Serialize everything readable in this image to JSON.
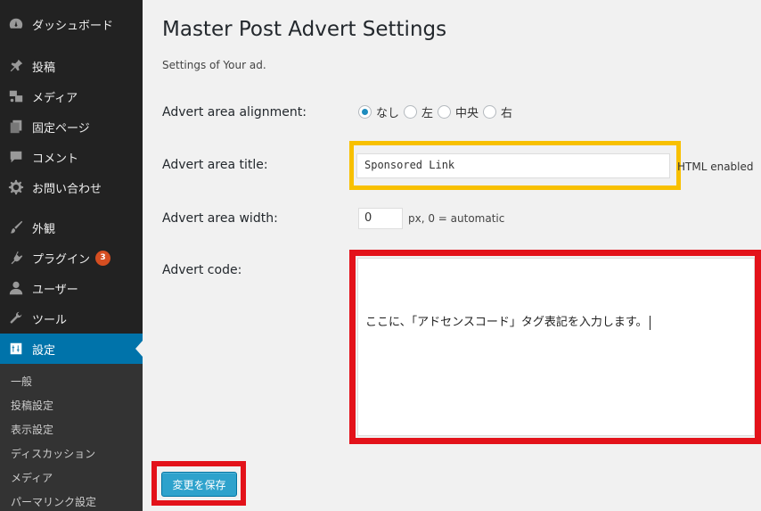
{
  "sidebar": {
    "items": [
      {
        "label": "ダッシュボード",
        "icon": "dashboard-icon"
      },
      {
        "label": "投稿",
        "icon": "pin-icon"
      },
      {
        "label": "メディア",
        "icon": "media-icon"
      },
      {
        "label": "固定ページ",
        "icon": "pages-icon"
      },
      {
        "label": "コメント",
        "icon": "comment-icon"
      },
      {
        "label": "お問い合わせ",
        "icon": "gear-icon"
      },
      {
        "label": "外観",
        "icon": "brush-icon"
      },
      {
        "label": "プラグイン",
        "icon": "plugin-icon",
        "badge": "3"
      },
      {
        "label": "ユーザー",
        "icon": "user-icon"
      },
      {
        "label": "ツール",
        "icon": "wrench-icon"
      },
      {
        "label": "設定",
        "icon": "settings-icon",
        "active": true
      }
    ],
    "submenu": [
      "一般",
      "投稿設定",
      "表示設定",
      "ディスカッション",
      "メディア",
      "パーマリンク設定"
    ]
  },
  "page": {
    "title": "Master Post Advert Settings",
    "subtitle": "Settings of Your ad."
  },
  "form": {
    "alignment": {
      "label": "Advert area alignment:",
      "options": [
        "なし",
        "左",
        "中央",
        "右"
      ],
      "selected": "なし"
    },
    "title": {
      "label": "Advert area title:",
      "value": "Sponsored Link",
      "note": "HTML enabled"
    },
    "width": {
      "label": "Advert area width:",
      "value": "0",
      "note": "px, 0 = automatic"
    },
    "code": {
      "label": "Advert code:",
      "value": "ここに、「アドセンスコード」タグ表記を入力します。"
    },
    "save_label": "変更を保存"
  },
  "colors": {
    "accent": "#0073aa",
    "highlight_yellow": "#f8c000",
    "highlight_red": "#e3121a",
    "button": "#2ea2cc"
  }
}
